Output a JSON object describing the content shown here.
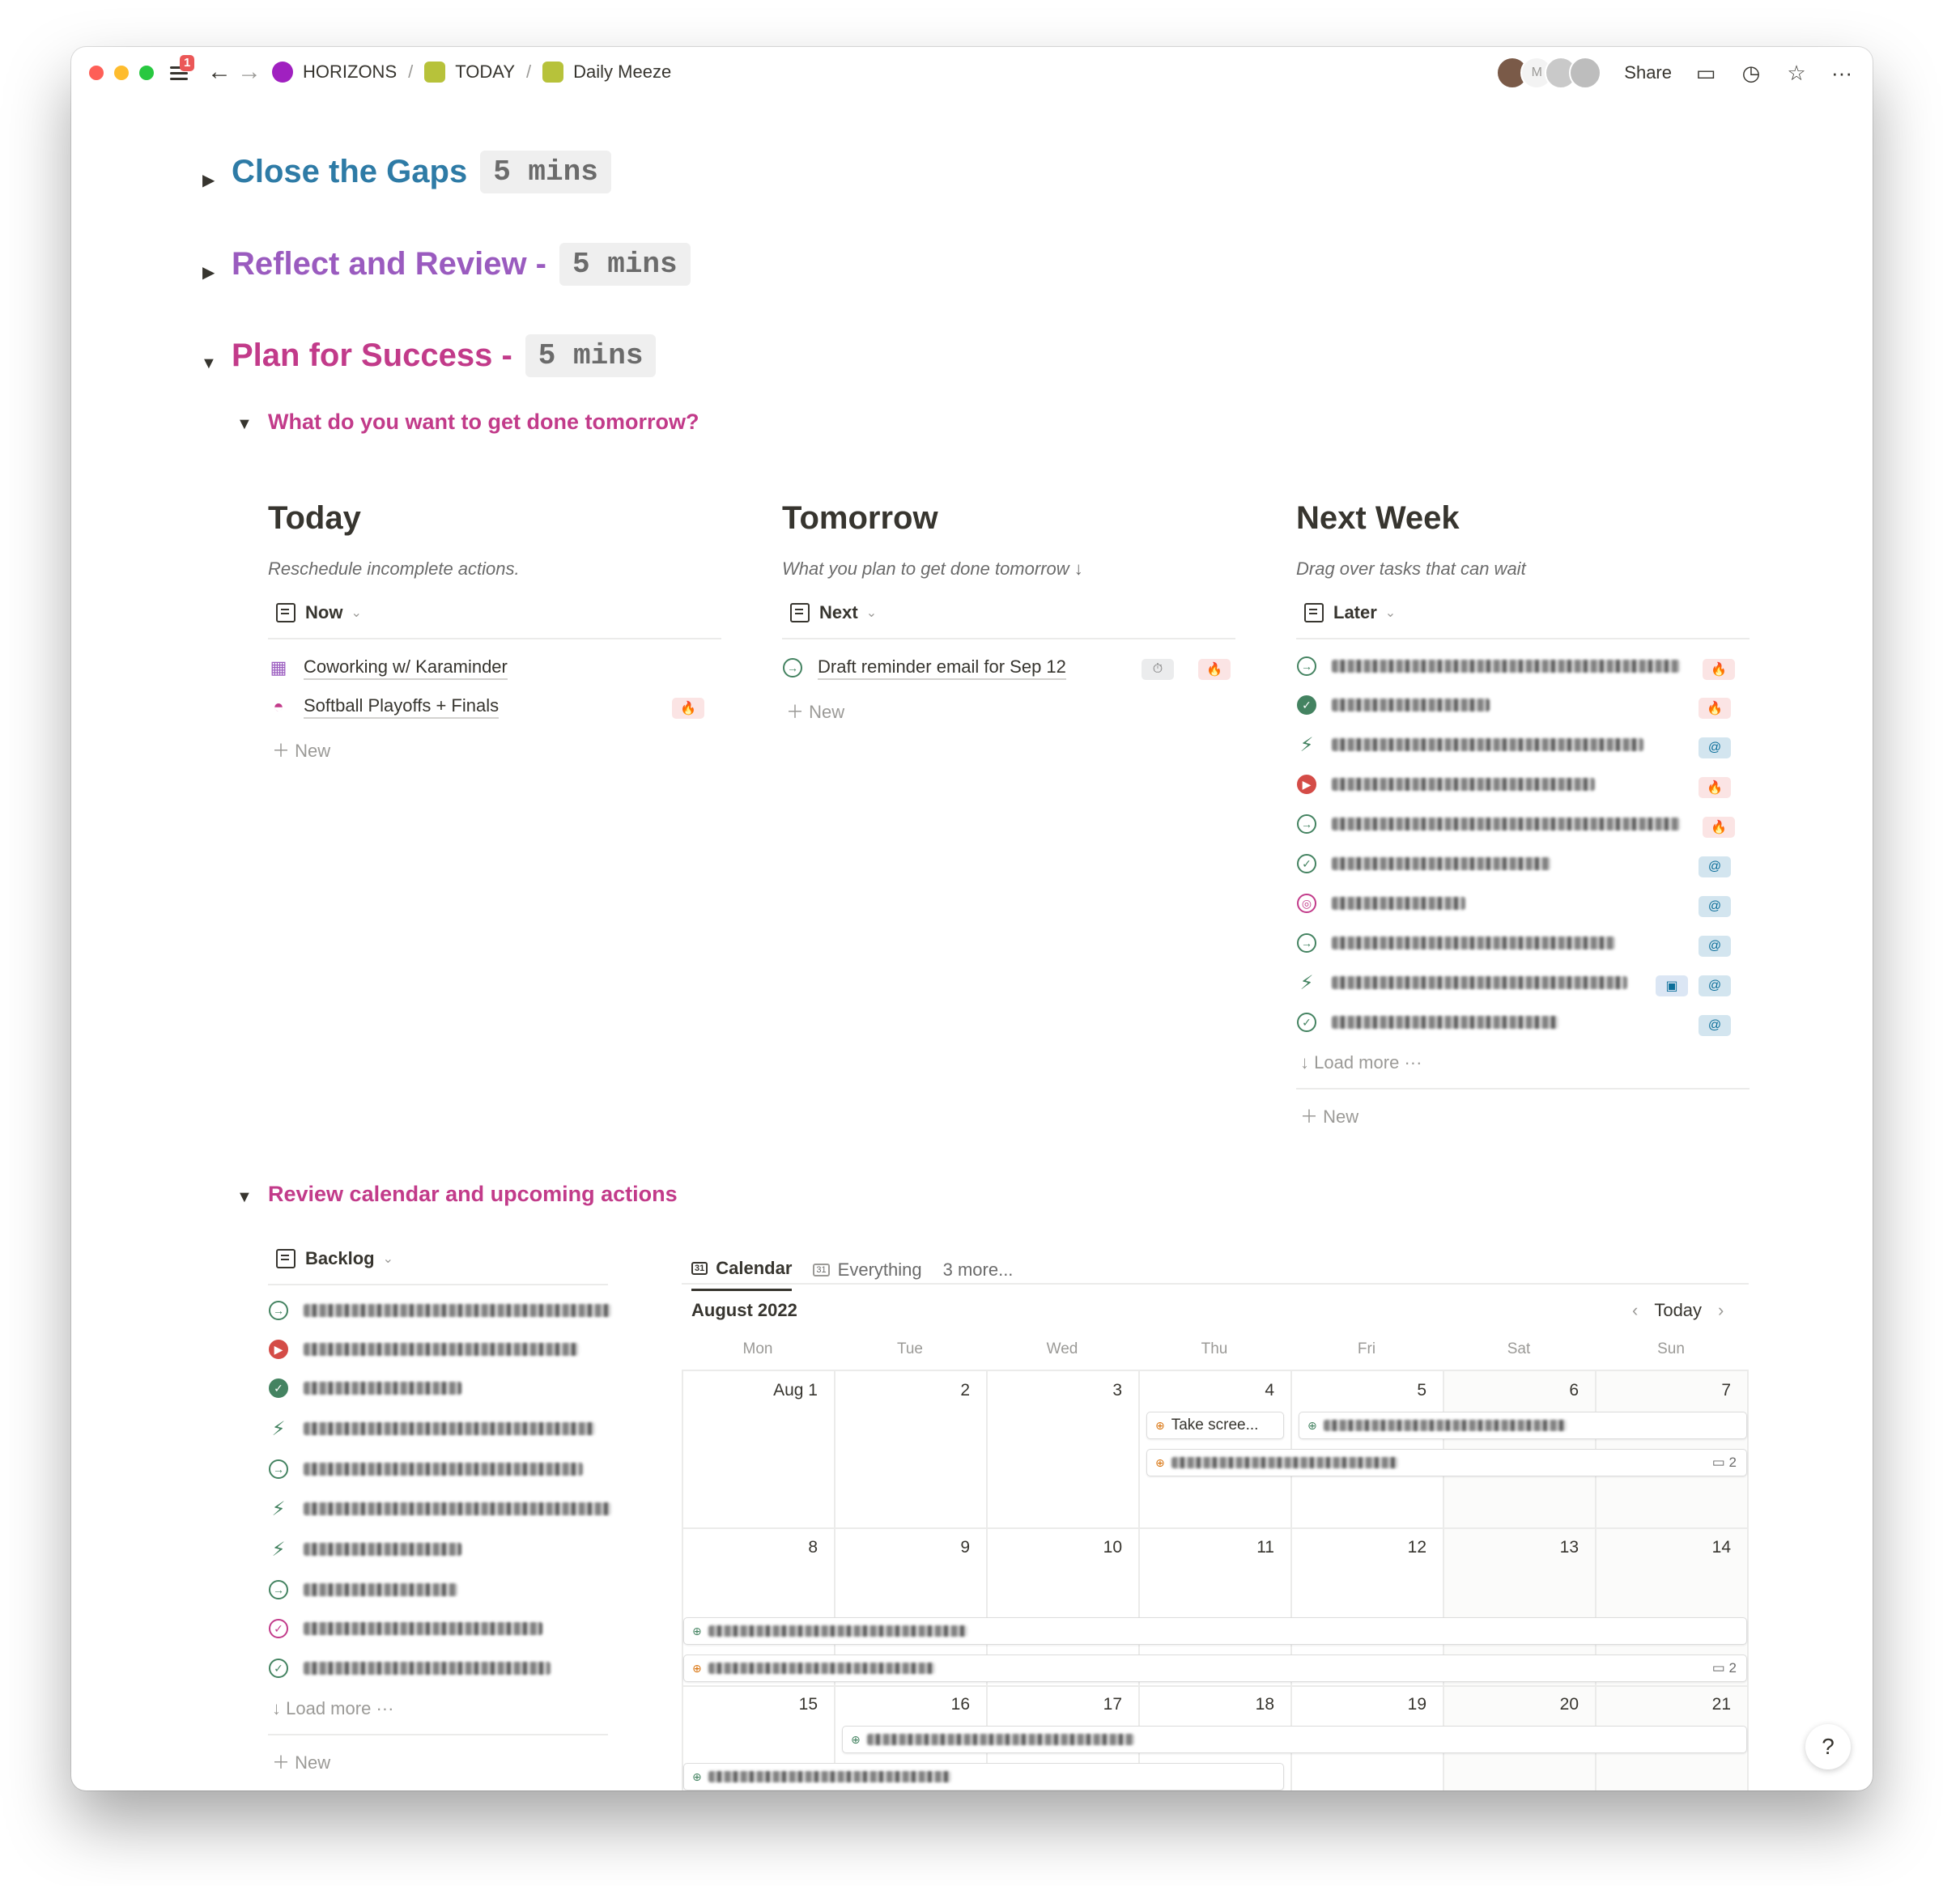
{
  "window": {
    "notification_count": "1",
    "breadcrumb": [
      "HORIZONS",
      "TODAY",
      "Daily Meeze"
    ],
    "avatar_initial": "M",
    "share_label": "Share"
  },
  "colors": {
    "blue": "#2e7ba6",
    "purple": "#9a5bbf",
    "pink": "#c23b8a",
    "green": "#448361",
    "red": "#d44c47"
  },
  "sections": {
    "close_gaps": {
      "title": "Close the Gaps",
      "time": "5 mins"
    },
    "reflect": {
      "title": "Reflect and Review -",
      "time": "5 mins"
    },
    "plan": {
      "title": "Plan for Success -",
      "time": "5 mins"
    }
  },
  "plan": {
    "question": "What do you want to get done tomorrow?",
    "today": {
      "title": "Today",
      "subtitle": "Reschedule incomplete actions.",
      "view": "Now",
      "items": [
        "Coworking w/ Karaminder",
        "Softball Playoffs + Finals"
      ],
      "new_label": "New"
    },
    "tomorrow": {
      "title": "Tomorrow",
      "subtitle": "What you plan to get done tomorrow ↓",
      "view": "Next",
      "items": [
        "Draft reminder email for Sep 12"
      ],
      "new_label": "New"
    },
    "next_week": {
      "title": "Next Week",
      "subtitle": "Drag over tasks that can wait",
      "view": "Later",
      "load_more": "Load more",
      "new_label": "New"
    }
  },
  "review": {
    "title": "Review calendar and upcoming actions",
    "backlog_view": "Backlog",
    "load_more": "Load more",
    "new_label": "New",
    "tabs": [
      "Calendar",
      "Everything",
      "3 more..."
    ],
    "month": "August 2022",
    "today_label": "Today",
    "weekdays": [
      "Mon",
      "Tue",
      "Wed",
      "Thu",
      "Fri",
      "Sat",
      "Sun"
    ],
    "week1": [
      "Aug 1",
      "2",
      "3",
      "4",
      "5",
      "6",
      "7"
    ],
    "week2": [
      "8",
      "9",
      "10",
      "11",
      "12",
      "13",
      "14"
    ],
    "week3": [
      "15",
      "16",
      "17",
      "18",
      "19",
      "20",
      "21"
    ],
    "event_take_screen": "Take scree...",
    "comment_count_a": "2",
    "comment_count_b": "2"
  },
  "help_label": "?"
}
